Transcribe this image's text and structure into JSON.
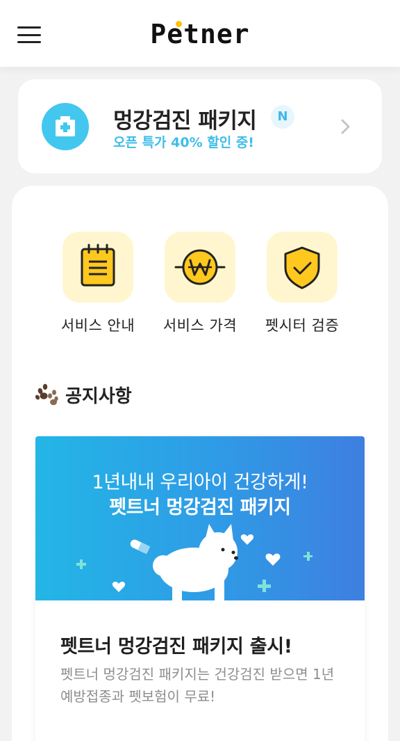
{
  "header": {
    "logo": "Petner",
    "menu_icon": "hamburger-menu-icon"
  },
  "package": {
    "icon": "hospital-icon",
    "title": "멍강검진 패키지",
    "badge": "N",
    "subtitle": "오픈 특가 40% 할인 중!",
    "chevron_icon": "chevron-right-icon"
  },
  "services": [
    {
      "label": "서비스 안내",
      "icon": "notepad-icon"
    },
    {
      "label": "서비스 가격",
      "icon": "won-coin-icon"
    },
    {
      "label": "펫시터 검증",
      "icon": "shield-check-icon"
    }
  ],
  "notice": {
    "icon": "paw-print-icon",
    "section_title": "공지사항",
    "banner_line1": "1년내내 우리아이 건강하게!",
    "banner_line2": "펫트너 멍강검진 패키지",
    "title": "펫트너 멍강검진 패키지 출시!",
    "description": "펫트너 멍강검진 패키지는 건강검진 받으면 1년 예방접종과 펫보험이 무료!"
  },
  "colors": {
    "accent_blue": "#3fbde9",
    "accent_yellow": "#ffc107",
    "service_tile": "#fff6cf",
    "banner_start": "#23b6e6",
    "banner_end": "#3e7fe0"
  }
}
